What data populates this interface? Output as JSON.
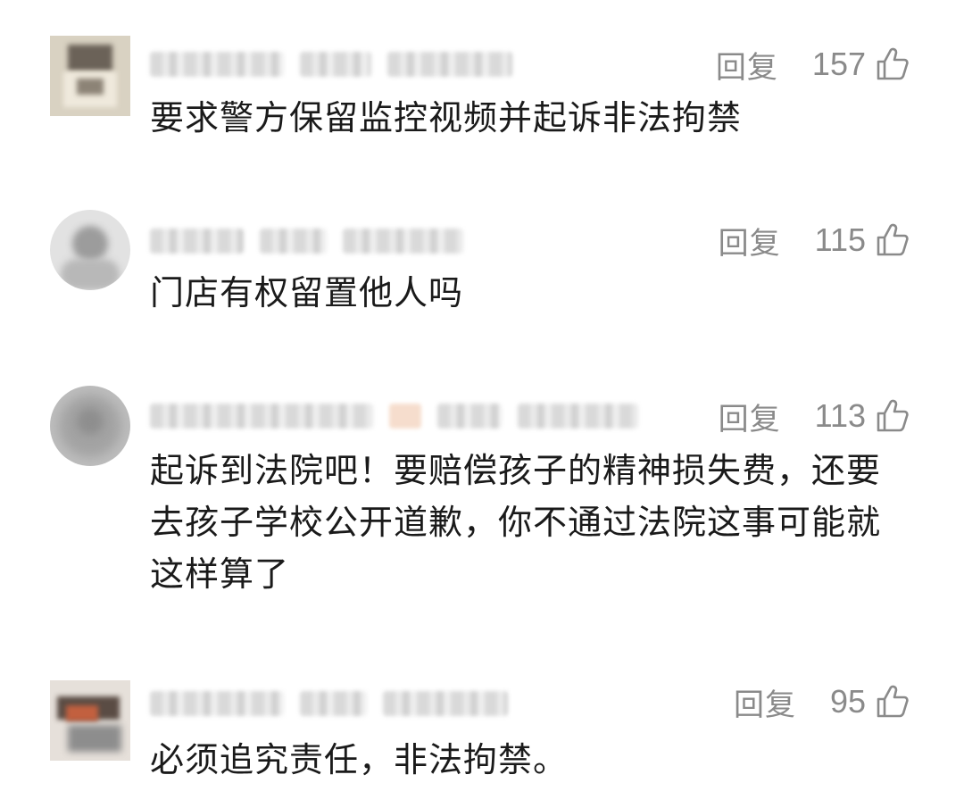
{
  "comments": [
    {
      "reply_label": "回复",
      "likes": "157",
      "text": "要求警方保留监控视频并起诉非法拘禁",
      "avatar_icon": "user-avatar-icon",
      "like_icon": "thumbs-up-icon"
    },
    {
      "reply_label": "回复",
      "likes": "115",
      "text": "门店有权留置他人吗",
      "avatar_icon": "user-avatar-icon",
      "like_icon": "thumbs-up-icon"
    },
    {
      "reply_label": "回复",
      "likes": "113",
      "text": "起诉到法院吧！要赔偿孩子的精神损失费，还要去孩子学校公开道歉，你不通过法院这事可能就这样算了",
      "avatar_icon": "user-avatar-icon",
      "like_icon": "thumbs-up-icon"
    },
    {
      "reply_label": "回复",
      "likes": "95",
      "text": "必须追究责任，非法拘禁。",
      "avatar_icon": "user-avatar-icon",
      "like_icon": "thumbs-up-icon"
    }
  ],
  "colors": {
    "text": "#1a1a1a",
    "meta_gray": "#8a8a8a",
    "background": "#ffffff"
  }
}
